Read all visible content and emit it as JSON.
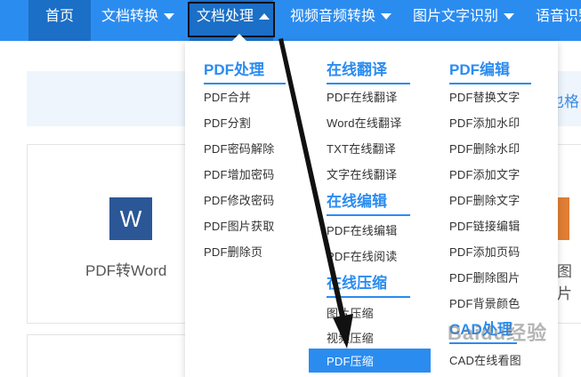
{
  "nav": {
    "home": "首页",
    "doc_convert": "文档转换",
    "doc_process": "文档处理",
    "video_audio": "视频音频转换",
    "image_text": "图片文字识别",
    "voice": "语音识别"
  },
  "background": {
    "banner_text": "也格",
    "word_icon_letter": "W",
    "card_pdf_to_word": "PDF转Word",
    "card_right_partial": "图片"
  },
  "dropdown": {
    "col1": {
      "title": "PDF处理",
      "items": [
        "PDF合并",
        "PDF分割",
        "PDF密码解除",
        "PDF增加密码",
        "PDF修改密码",
        "PDF图片获取",
        "PDF删除页"
      ]
    },
    "col2a": {
      "title": "在线翻译",
      "items": [
        "PDF在线翻译",
        "Word在线翻译",
        "TXT在线翻译",
        "文字在线翻译"
      ]
    },
    "col2b": {
      "title": "在线编辑",
      "items": [
        "PDF在线编辑",
        "PDF在线阅读"
      ]
    },
    "col2c": {
      "title": "在线压缩",
      "items": [
        "图片压缩",
        "视频压缩",
        "PDF压缩"
      ]
    },
    "col3a": {
      "title": "PDF编辑",
      "items": [
        "PDF替换文字",
        "PDF添加水印",
        "PDF删除水印",
        "PDF添加文字",
        "PDF删除文字",
        "PDF链接编辑",
        "PDF添加页码",
        "PDF删除图片",
        "PDF背景颜色"
      ]
    },
    "col3b": {
      "title": "CAD处理",
      "items": [
        "CAD在线看图"
      ]
    }
  },
  "colors": {
    "nav_bg": "#2b8cf0",
    "nav_active": "#1b6fc6",
    "accent": "#2b8cf0"
  },
  "watermark": "Baidu经验"
}
